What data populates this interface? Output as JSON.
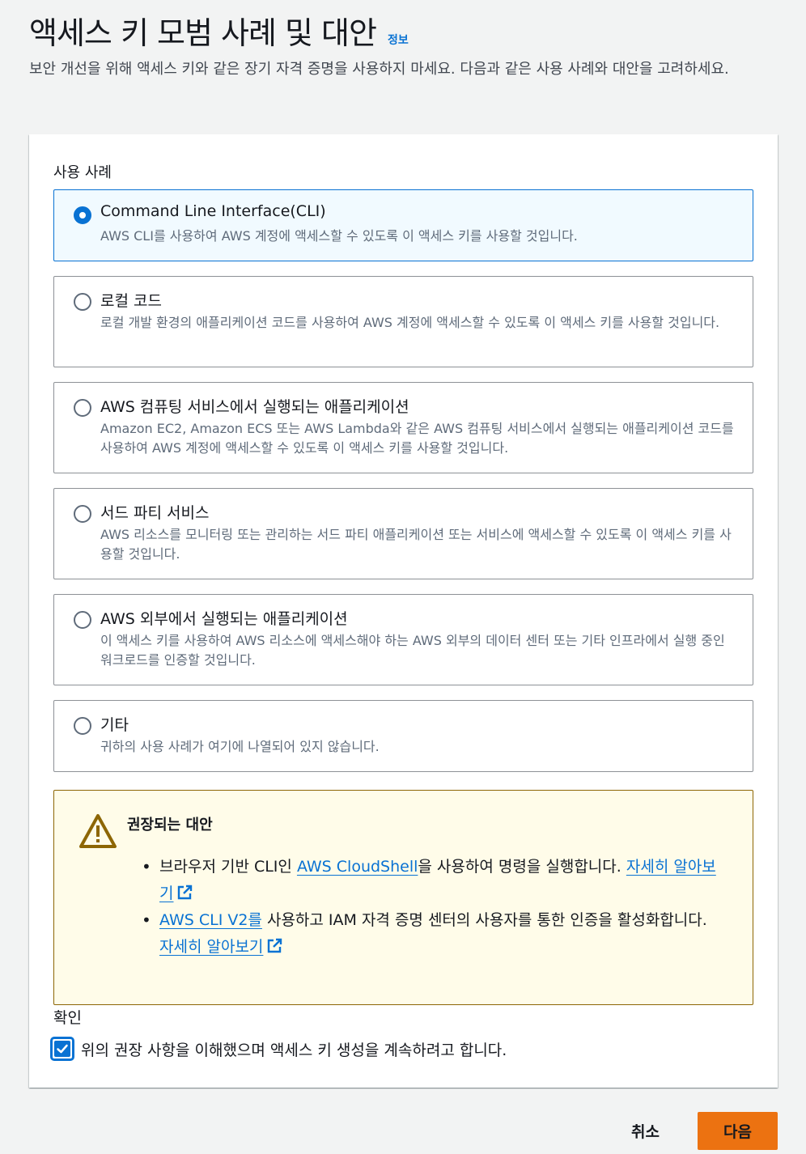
{
  "header": {
    "title": "액세스 키 모범 사례 및 대안",
    "info_link": "정보",
    "description": "보안 개선을 위해 액세스 키와 같은 장기 자격 증명을 사용하지 마세요. 다음과 같은 사용 사례와 대안을 고려하세요."
  },
  "use_cases": {
    "label": "사용 사례",
    "selected_index": 0,
    "options": [
      {
        "title": "Command Line Interface(CLI)",
        "description": "AWS CLI를 사용하여 AWS 계정에 액세스할 수 있도록 이 액세스 키를 사용할 것입니다."
      },
      {
        "title": "로컬 코드",
        "description": "로컬 개발 환경의 애플리케이션 코드를 사용하여 AWS 계정에 액세스할 수 있도록 이 액세스 키를 사용할 것입니다."
      },
      {
        "title": "AWS 컴퓨팅 서비스에서 실행되는 애플리케이션",
        "description": "Amazon EC2, Amazon ECS 또는 AWS Lambda와 같은 AWS 컴퓨팅 서비스에서 실행되는 애플리케이션 코드를 사용하여 AWS 계정에 액세스할 수 있도록 이 액세스 키를 사용할 것입니다."
      },
      {
        "title": "서드 파티 서비스",
        "description": "AWS 리소스를 모니터링 또는 관리하는 서드 파티 애플리케이션 또는 서비스에 액세스할 수 있도록 이 액세스 키를 사용할 것입니다."
      },
      {
        "title": "AWS 외부에서 실행되는 애플리케이션",
        "description": "이 액세스 키를 사용하여 AWS 리소스에 액세스해야 하는 AWS 외부의 데이터 센터 또는 기타 인프라에서 실행 중인 워크로드를 인증할 것입니다."
      },
      {
        "title": "기타",
        "description": "귀하의 사용 사례가 여기에 나열되어 있지 않습니다."
      }
    ]
  },
  "alert": {
    "title": "권장되는 대안",
    "item1": {
      "prefix": "브라우저 기반 CLI인 ",
      "link": "AWS CloudShell",
      "middle": "을 사용하여 명령을 실행합니다. ",
      "learn_more": "자세히 알아보기"
    },
    "item2": {
      "link": "AWS CLI V2를",
      "middle": " 사용하고 IAM 자격 증명 센터의 사용자를 통한 인증을 활성화합니다. ",
      "learn_more": "자세히 알아보기"
    }
  },
  "confirmation": {
    "label": "확인",
    "checkbox_text": "위의 권장 사항을 이해했으며 액세스 키 생성을 계속하려고 합니다.",
    "checked": true
  },
  "footer": {
    "cancel_label": "취소",
    "next_label": "다음"
  },
  "colors": {
    "accent": "#0972d3",
    "primary_button": "#ec7211",
    "warning_bg": "#fffce9",
    "warning_border": "#8d6605"
  }
}
